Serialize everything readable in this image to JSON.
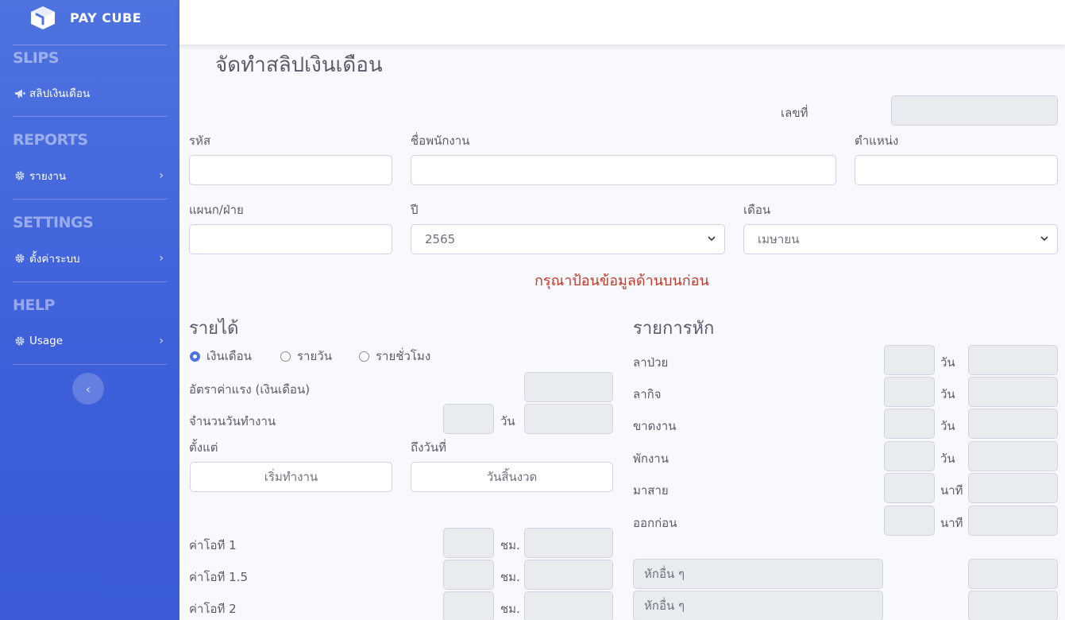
{
  "sidebar": {
    "brand": "PAY CUBE",
    "sections": [
      {
        "heading": "SLIPS",
        "items": [
          {
            "label": "สลิปเงินเดือน",
            "icon": "megaphone-icon"
          }
        ]
      },
      {
        "heading": "REPORTS",
        "items": [
          {
            "label": "รายงาน",
            "icon": "gear-icon"
          }
        ]
      },
      {
        "heading": "SETTINGS",
        "items": [
          {
            "label": "ตั้งค่าระบบ",
            "icon": "gear-icon"
          }
        ]
      },
      {
        "heading": "HELP",
        "items": [
          {
            "label": "Usage",
            "icon": "gear-icon"
          }
        ]
      }
    ],
    "toggle_icon": "chevron-left-icon"
  },
  "page": {
    "title": "จัดทำสลิปเงินเดือน",
    "number_label": "เลขที่",
    "code_label": "รหัส",
    "name_label": "ชื่อพนักงาน",
    "position_label": "ตำแหน่ง",
    "department_label": "แผนก/ฝ่าย",
    "year_label": "ปี",
    "year_value": "2565",
    "month_label": "เดือน",
    "month_value": "เมษายน",
    "warning": "กรุณาป้อนข้อมูลด้านบนก่อน"
  },
  "income": {
    "title": "รายได้",
    "pay_types": [
      "เงินเดือน",
      "รายวัน",
      "รายชั่วโมง"
    ],
    "selected_pay_type": "เงินเดือน",
    "rate_label": "อัตราค่าแรง (เงินเดือน)",
    "workdays_label": "จำนวนวันทำงาน",
    "day_unit": "วัน",
    "from_label": "ตั้งแต่",
    "to_label": "ถึงวันที่",
    "from_button": "เริ่มทำงาน",
    "to_button": "วันสิ้นงวด",
    "ot_rows": [
      {
        "label": "ค่าโอที 1",
        "unit": "ชม."
      },
      {
        "label": "ค่าโอที 1.5",
        "unit": "ชม."
      },
      {
        "label": "ค่าโอที 2",
        "unit": "ชม."
      }
    ]
  },
  "deductions": {
    "title": "รายการหัก",
    "rows": [
      {
        "label": "ลาป่วย",
        "unit": "วัน"
      },
      {
        "label": "ลากิจ",
        "unit": "วัน"
      },
      {
        "label": "ขาดงาน",
        "unit": "วัน"
      },
      {
        "label": "พักงาน",
        "unit": "วัน"
      },
      {
        "label": "มาสาย",
        "unit": "นาที"
      },
      {
        "label": "ออกก่อน",
        "unit": "นาที"
      }
    ],
    "other_rows": [
      {
        "placeholder": "หักอื่น ๆ"
      },
      {
        "placeholder": "หักอื่น ๆ"
      }
    ]
  }
}
